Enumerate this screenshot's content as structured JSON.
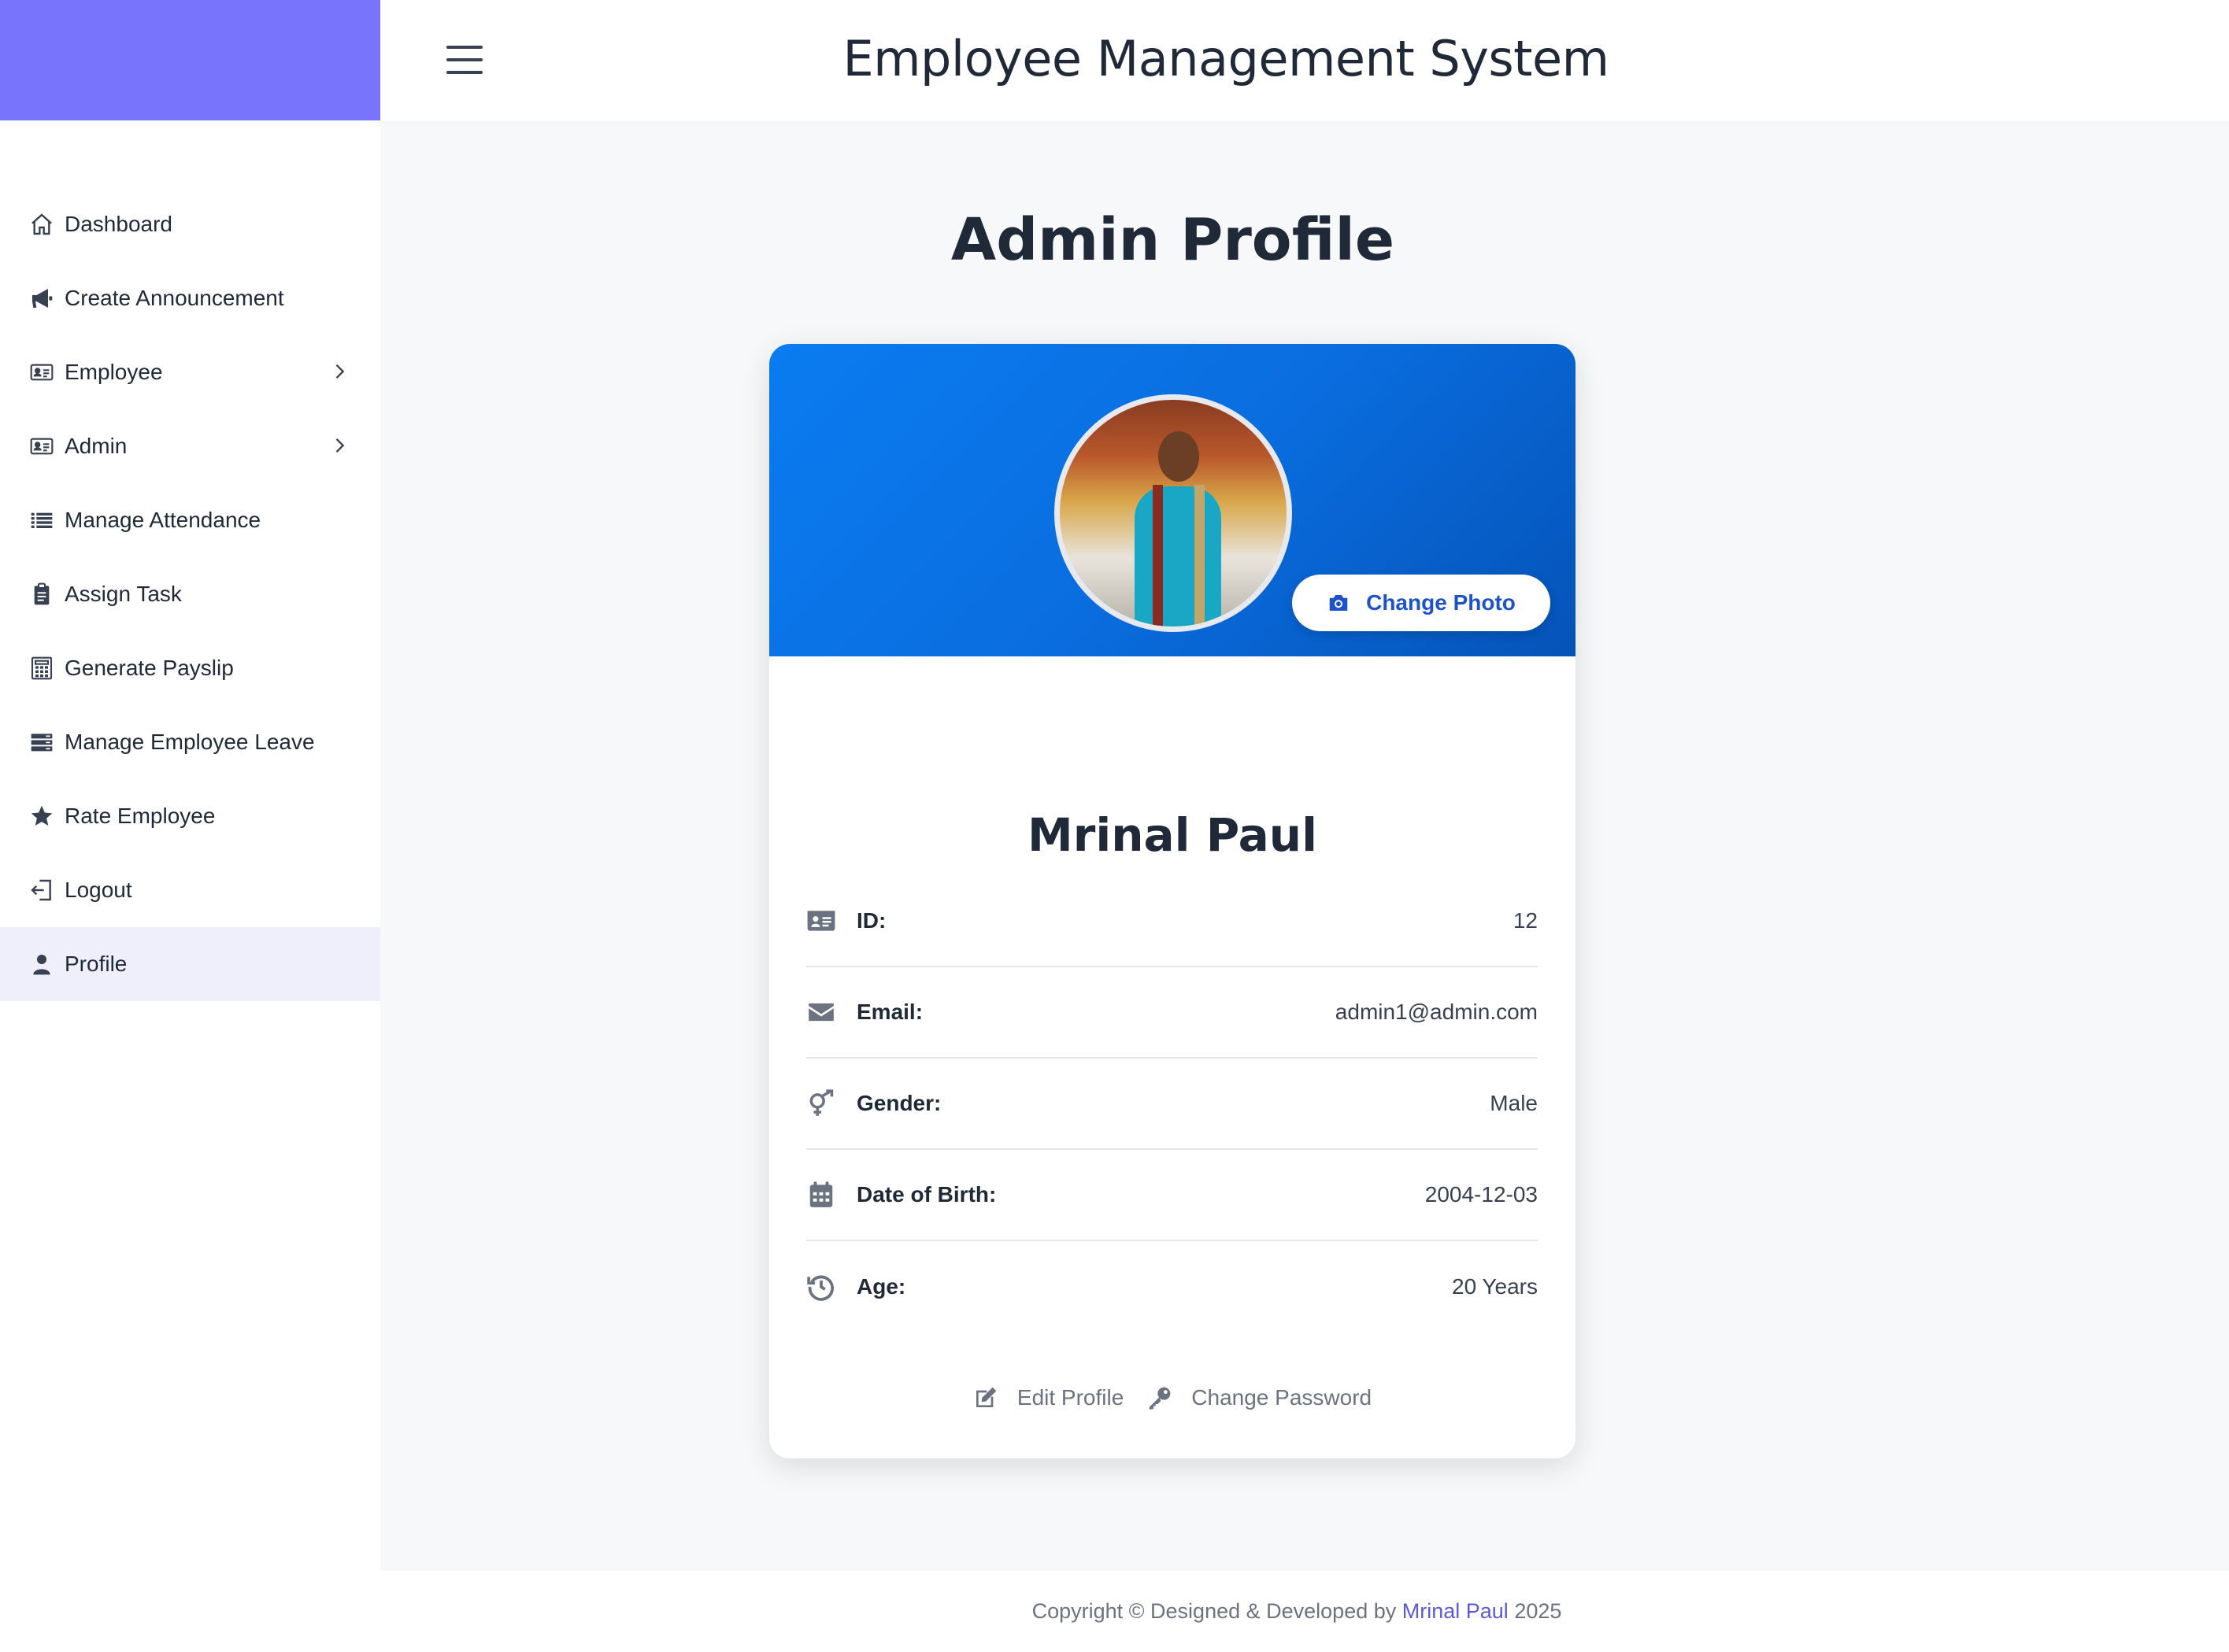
{
  "header": {
    "title": "Employee Management System"
  },
  "sidebar": {
    "items": [
      {
        "label": "Dashboard",
        "icon": "home-icon",
        "submenu": false,
        "active": false
      },
      {
        "label": "Create Announcement",
        "icon": "megaphone-icon",
        "submenu": false,
        "active": false
      },
      {
        "label": "Employee",
        "icon": "id-card-icon",
        "submenu": true,
        "active": false
      },
      {
        "label": "Admin",
        "icon": "id-card-icon",
        "submenu": true,
        "active": false
      },
      {
        "label": "Manage Attendance",
        "icon": "list-icon",
        "submenu": false,
        "active": false
      },
      {
        "label": "Assign Task",
        "icon": "clipboard-icon",
        "submenu": false,
        "active": false
      },
      {
        "label": "Generate Payslip",
        "icon": "calculator-icon",
        "submenu": false,
        "active": false
      },
      {
        "label": "Manage Employee Leave",
        "icon": "server-icon",
        "submenu": false,
        "active": false
      },
      {
        "label": "Rate Employee",
        "icon": "star-icon",
        "submenu": false,
        "active": false
      },
      {
        "label": "Logout",
        "icon": "logout-icon",
        "submenu": false,
        "active": false
      },
      {
        "label": "Profile",
        "icon": "user-icon",
        "submenu": false,
        "active": true
      }
    ]
  },
  "main": {
    "title": "Admin Profile",
    "profile": {
      "name": "Mrinal Paul",
      "change_photo_label": "Change Photo",
      "fields": [
        {
          "label": "ID:",
          "value": "12",
          "icon": "id-card-icon"
        },
        {
          "label": "Email:",
          "value": "admin1@admin.com",
          "icon": "envelope-icon"
        },
        {
          "label": "Gender:",
          "value": "Male",
          "icon": "gender-icon"
        },
        {
          "label": "Date of Birth:",
          "value": "2004-12-03",
          "icon": "calendar-icon"
        },
        {
          "label": "Age:",
          "value": "20 Years",
          "icon": "history-icon"
        }
      ],
      "actions": {
        "edit_profile": "Edit Profile",
        "change_password": "Change Password"
      }
    }
  },
  "footer": {
    "prefix": "Copyright © Designed & Developed by ",
    "author": "Mrinal Paul",
    "suffix": " 2025"
  },
  "colors": {
    "brand": "#7874fb",
    "banner": "#0a6ee0",
    "active_bg": "#efeffb",
    "link": "#5b5bd6",
    "button_text": "#1d52c8"
  }
}
